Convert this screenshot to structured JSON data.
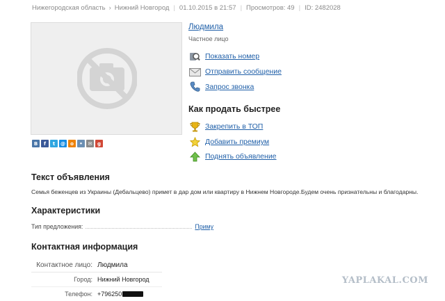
{
  "meta": {
    "region": "Нижегородская область",
    "city": "Нижний Новгород",
    "date": "01.10.2015 в 21:57",
    "views": "Просмотров: 49",
    "id": "ID: 2482028"
  },
  "seller": {
    "name": "Людмила",
    "type": "Частное лицо"
  },
  "contact_actions": [
    {
      "label": "Показать номер",
      "icon": "magnifier-phone-icon"
    },
    {
      "label": "Отправить сообщение",
      "icon": "envelope-icon"
    },
    {
      "label": "Запрос звонка",
      "icon": "handset-icon"
    }
  ],
  "sell_faster": {
    "title": "Как продать быстрее",
    "items": [
      {
        "label": "Закрепить в ТОП",
        "icon": "trophy-icon"
      },
      {
        "label": "Добавить премиум",
        "icon": "star-icon"
      },
      {
        "label": "Поднять объявление",
        "icon": "up-arrow-icon"
      }
    ]
  },
  "share_icons": [
    {
      "glyph": "В",
      "name": "vk-share-icon",
      "color": "#4a76a8"
    },
    {
      "glyph": "f",
      "name": "facebook-share-icon",
      "color": "#3b5998"
    },
    {
      "glyph": "t",
      "name": "twitter-share-icon",
      "color": "#2fa6e0"
    },
    {
      "glyph": "@",
      "name": "mailru-share-icon",
      "color": "#168de2"
    },
    {
      "glyph": "o",
      "name": "odnoklassniki-share-icon",
      "color": "#ee8208"
    },
    {
      "glyph": "•",
      "name": "livejournal-share-icon",
      "color": "#6b8fb3"
    },
    {
      "glyph": "✉",
      "name": "email-share-icon",
      "color": "#8a8a8a"
    },
    {
      "glyph": "g",
      "name": "googleplus-share-icon",
      "color": "#d14836"
    }
  ],
  "ad_text": {
    "title": "Текст объявления",
    "body": "Семья беженцев из Украины (Дебальцево) примет в дар дом или квартиру в Нижнем Новгороде.Будем очень признательны и благодарны."
  },
  "characteristics": {
    "title": "Характеристики",
    "offer_label": "Тип предложения:",
    "offer_value": "Приму"
  },
  "contacts": {
    "title": "Контактная информация",
    "person_label": "Контактное лицо:",
    "person_value": "Людмила",
    "city_label": "Город:",
    "city_value": "Нижний Новгород",
    "phone_label": "Телефон:",
    "phone_value": "+796250"
  },
  "watermark": "YAPLAKAL.COM",
  "colors": {
    "link": "#1f5fa8",
    "meta": "#8a8a8a",
    "photo_bg": "#efefef"
  }
}
